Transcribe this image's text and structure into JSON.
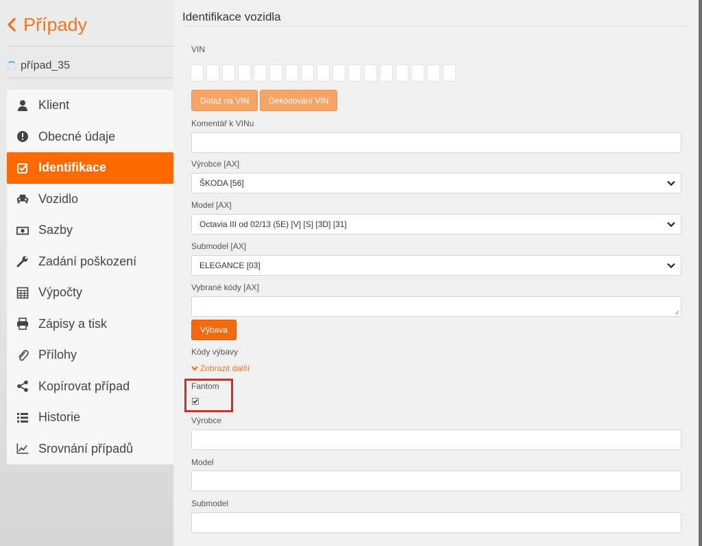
{
  "sidebar": {
    "back_label": "Případy",
    "case_name": "případ_35",
    "items": [
      {
        "label": "Klient",
        "icon": "user-icon"
      },
      {
        "label": "Obecné údaje",
        "icon": "exclamation-icon"
      },
      {
        "label": "Identifikace",
        "icon": "check-square-icon",
        "active": true
      },
      {
        "label": "Vozidlo",
        "icon": "car-icon"
      },
      {
        "label": "Sazby",
        "icon": "money-icon"
      },
      {
        "label": "Zadání poškození",
        "icon": "wrench-icon"
      },
      {
        "label": "Výpočty",
        "icon": "calculator-icon"
      },
      {
        "label": "Zápisy a tisk",
        "icon": "print-icon"
      },
      {
        "label": "Přílohy",
        "icon": "paperclip-icon"
      },
      {
        "label": "Kopírovat případ",
        "icon": "share-icon"
      },
      {
        "label": "Historie",
        "icon": "list-icon"
      },
      {
        "label": "Srovnání případů",
        "icon": "line-chart-icon"
      }
    ]
  },
  "main": {
    "title": "Identifikace vozidla",
    "vin_label": "VIN",
    "vin_box_count": 17,
    "btn_vin_query": "Dotaz na VIN",
    "btn_vin_decode": "Dekódování VIN",
    "vin_comment_label": "Komentář k VINu",
    "vin_comment_value": "",
    "manufacturer_label": "Výrobce [AX]",
    "manufacturer_value": "ŠKODA [56]",
    "model_label": "Model [AX]",
    "model_value": "Octavia III od 02/13 (5E) [V] [S] [3D] [31]",
    "submodel_label": "Submodel [AX]",
    "submodel_value": "ELEGANCE [03]",
    "selected_codes_label": "Vybrané kódy [AX]",
    "selected_codes_value": "",
    "btn_equipment": "Výbava",
    "equipment_codes_label": "Kódy výbavy",
    "show_more_label": "Zobrazit další",
    "fantom_label": "Fantom",
    "fantom_checked": true,
    "fantom_manufacturer_label": "Výrobce",
    "fantom_model_label": "Model",
    "fantom_submodel_label": "Submodel"
  },
  "colors": {
    "accent": "#ff6a00",
    "accent_light": "#f5a466",
    "highlight_box": "#d42a2a"
  }
}
